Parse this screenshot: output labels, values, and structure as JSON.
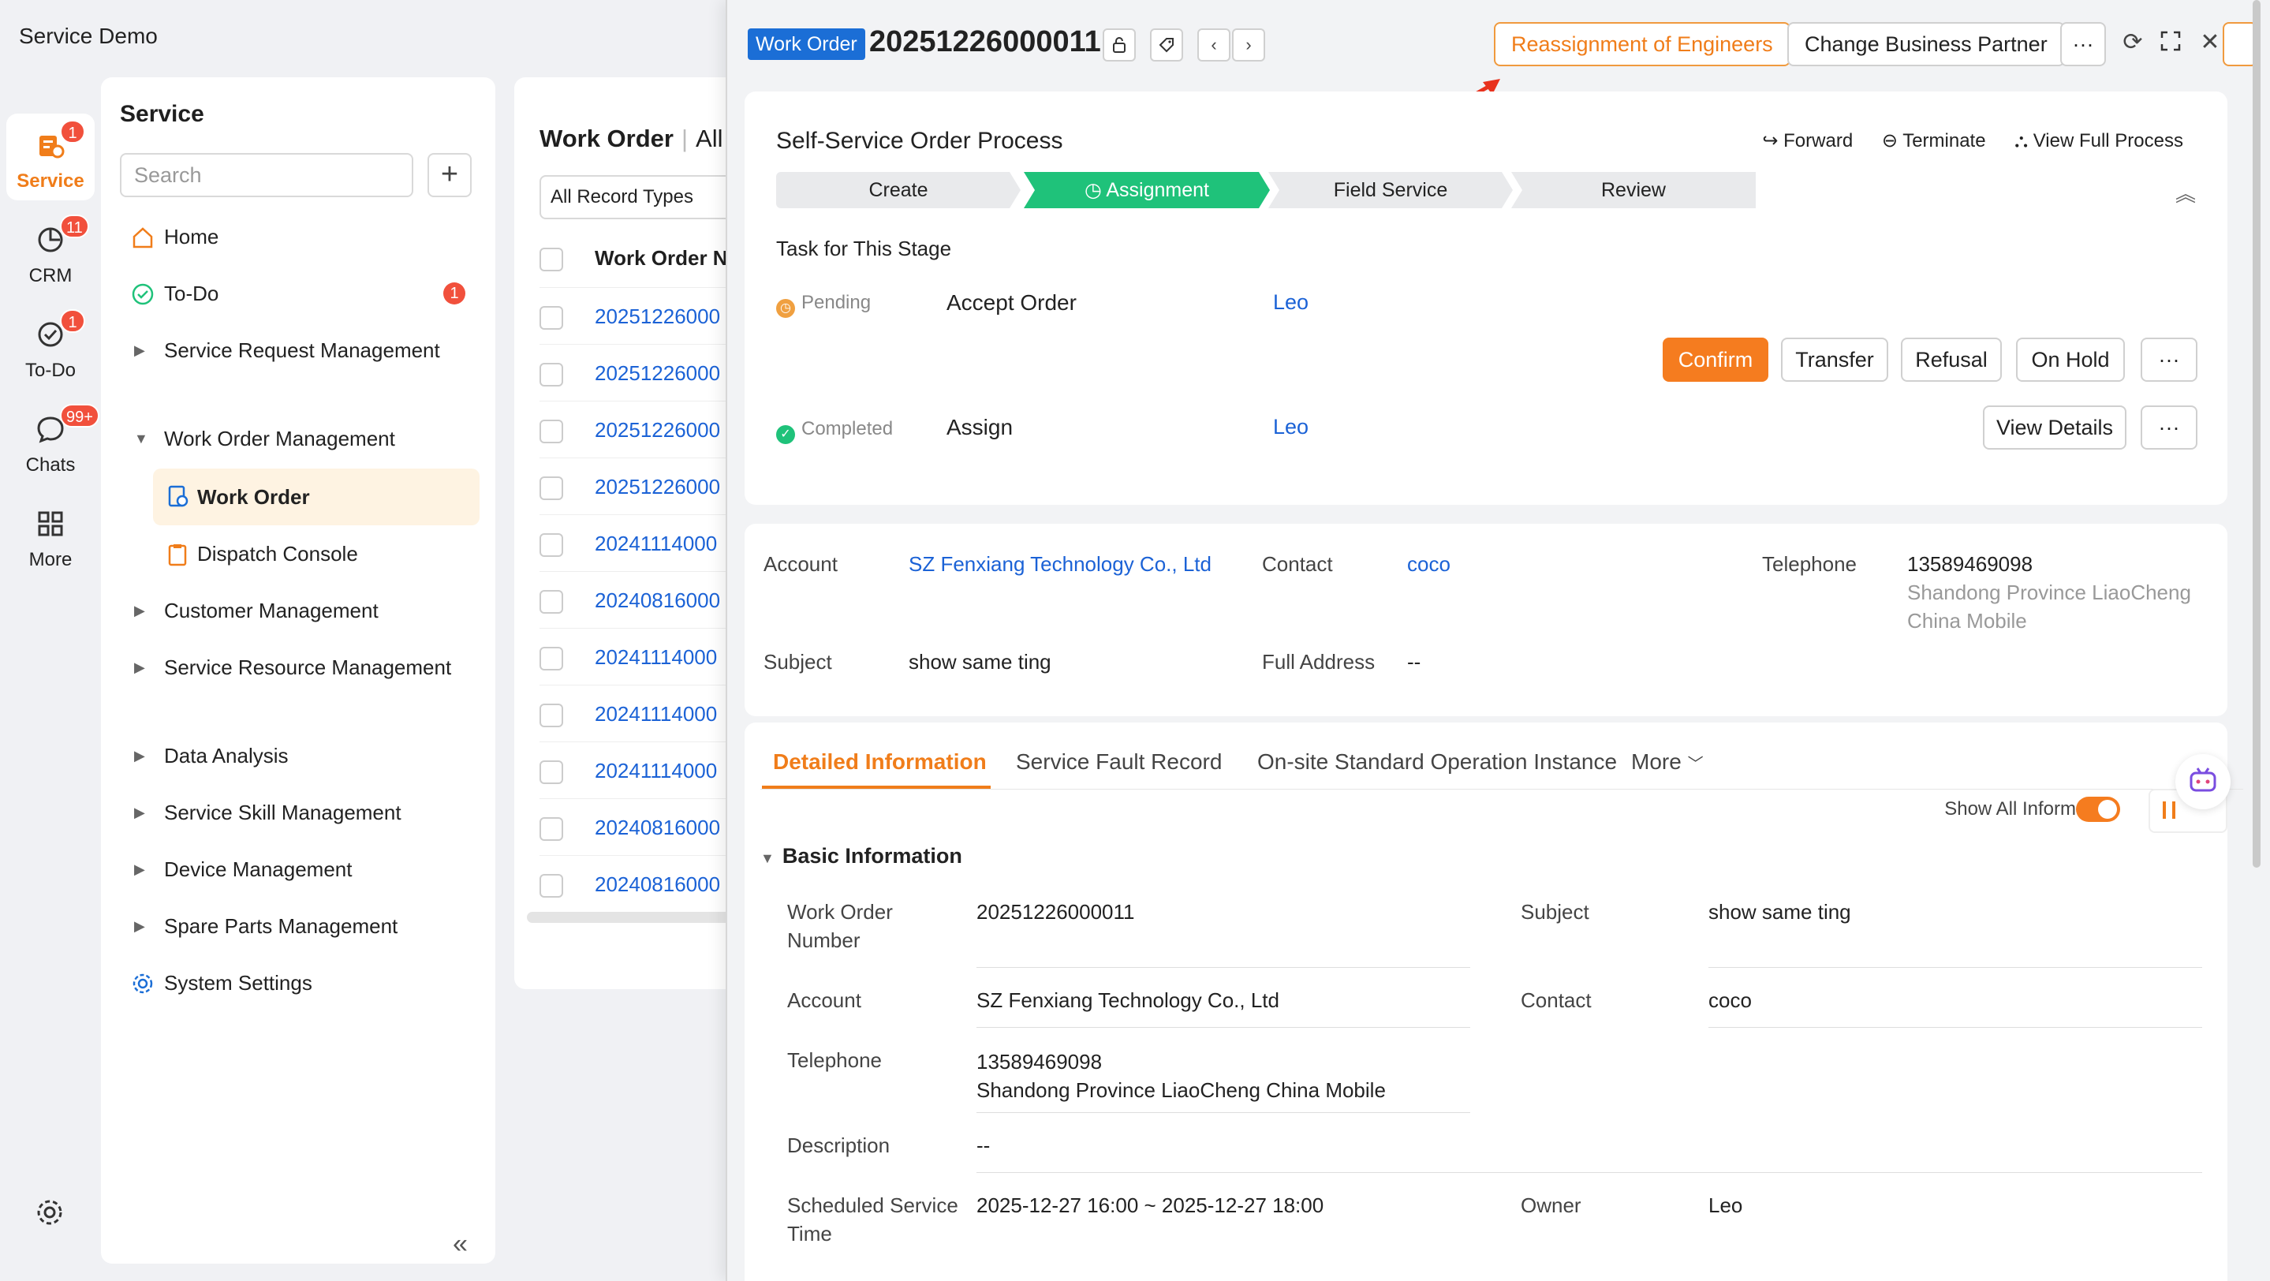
{
  "app": {
    "title": "Service Demo"
  },
  "rail": [
    {
      "label": "Service",
      "badge": "1",
      "icon": "service-icon"
    },
    {
      "label": "CRM",
      "badge": "11",
      "icon": "crm-icon"
    },
    {
      "label": "To-Do",
      "badge": "1",
      "icon": "todo-check-icon"
    },
    {
      "label": "Chats",
      "badge": "99+",
      "icon": "chat-icon"
    },
    {
      "label": "More",
      "badge": "",
      "icon": "grid-icon"
    }
  ],
  "menu": {
    "title": "Service",
    "search_placeholder": "Search",
    "items": [
      {
        "label": "Home"
      },
      {
        "label": "To-Do",
        "badge": "1"
      },
      {
        "label": "Service Request Management"
      },
      {
        "label": "Work Order Management"
      },
      {
        "label": "Work Order"
      },
      {
        "label": "Dispatch Console"
      },
      {
        "label": "Customer Management"
      },
      {
        "label": "Service Resource Management"
      },
      {
        "label": "Data Analysis"
      },
      {
        "label": "Service Skill Management"
      },
      {
        "label": "Device Management"
      },
      {
        "label": "Spare Parts Management"
      },
      {
        "label": "System Settings"
      }
    ]
  },
  "list": {
    "title": "Work Order",
    "title_suffix": "All",
    "filter": "All Record Types",
    "column": "Work Order N",
    "rows": [
      "20251226000",
      "20251226000",
      "20251226000",
      "20251226000",
      "20241114000",
      "20240816000",
      "20241114000",
      "20241114000",
      "20241114000",
      "20240816000",
      "20240816000"
    ]
  },
  "detail": {
    "tag": "Work Order",
    "number": "20251226000011",
    "reassign_label": "Reassignment of Engineers",
    "change_partner_label": "Change Business Partner",
    "more_label": "···",
    "process": {
      "title": "Self-Service Order Process",
      "forward": "Forward",
      "terminate": "Terminate",
      "view_full": "View Full Process",
      "steps": [
        "Create",
        "Assignment",
        "Field Service",
        "Review"
      ],
      "task_title": "Task for This Stage",
      "tasks": [
        {
          "status": "Pending",
          "name": "Accept Order",
          "owner": "Leo"
        },
        {
          "status": "Completed",
          "name": "Assign",
          "owner": "Leo"
        }
      ],
      "actions": {
        "confirm": "Confirm",
        "transfer": "Transfer",
        "refusal": "Refusal",
        "on_hold": "On Hold",
        "view_details": "View Details",
        "more": "···"
      }
    },
    "summary": {
      "account_label": "Account",
      "account": "SZ Fenxiang Technology Co., Ltd",
      "contact_label": "Contact",
      "contact": "coco",
      "telephone_label": "Telephone",
      "telephone": "13589469098",
      "telephone_loc1": "Shandong Province LiaoCheng",
      "telephone_loc2": "China Mobile",
      "subject_label": "Subject",
      "subject": "show same ting",
      "address_label": "Full Address",
      "address": "--"
    },
    "tabs": [
      "Detailed Information",
      "Service Fault Record",
      "On-site Standard Operation Instance",
      "More"
    ],
    "show_all": "Show All Information",
    "basic": {
      "title": "Basic Information",
      "wo_number_label": "Work Order Number",
      "wo_number": "20251226000011",
      "subject_label": "Subject",
      "subject": "show same ting",
      "account_label": "Account",
      "account": "SZ Fenxiang Technology Co., Ltd",
      "contact_label": "Contact",
      "contact": "coco",
      "telephone_label": "Telephone",
      "telephone": "13589469098",
      "telephone_loc": "Shandong Province LiaoCheng China Mobile",
      "description_label": "Description",
      "description": "--",
      "schedule_label": "Scheduled Service Time",
      "schedule": "2025-12-27 16:00 ~ 2025-12-27 18:00",
      "owner_label": "Owner",
      "owner": "Leo"
    }
  },
  "colors": {
    "accent": "#f57c1f",
    "link": "#1b62d6",
    "active_step": "#1fc27a",
    "tag": "#1b6ed6",
    "badge": "#f1503c"
  }
}
